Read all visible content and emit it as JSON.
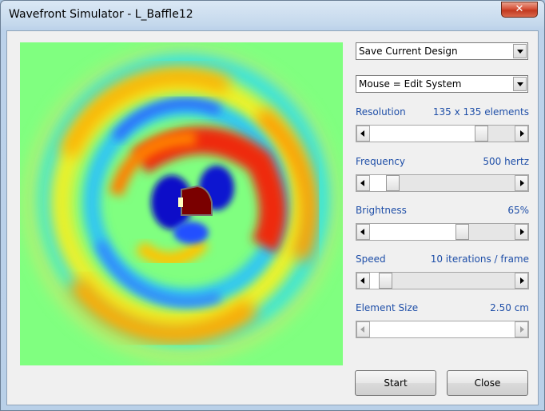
{
  "window": {
    "title": "Wavefront Simulator - L_Baffle12",
    "close_glyph": "✕"
  },
  "design_menu": {
    "selected": "Save Current Design"
  },
  "mouse_menu": {
    "selected": "Mouse = Edit System"
  },
  "params": [
    {
      "label": "Resolution",
      "value": "135 x 135 elements",
      "position": 0.8,
      "enabled": true
    },
    {
      "label": "Frequency",
      "value": "500 hertz",
      "position": 0.12,
      "enabled": true
    },
    {
      "label": "Brightness",
      "value": "65%",
      "position": 0.65,
      "enabled": true
    },
    {
      "label": "Speed",
      "value": "10 iterations / frame",
      "position": 0.07,
      "enabled": true
    },
    {
      "label": "Element Size",
      "value": "2.50 cm",
      "position": 0.0,
      "enabled": false
    }
  ],
  "buttons": {
    "start": "Start",
    "close": "Close"
  },
  "colors": {
    "label_blue": "#1f4fa8",
    "field_background": "#80ff80",
    "baffle": "#7a0000"
  },
  "icons": {
    "close": "close-icon",
    "dropdown": "chevron-down-icon",
    "scroll_left": "arrow-left-icon",
    "scroll_right": "arrow-right-icon"
  }
}
